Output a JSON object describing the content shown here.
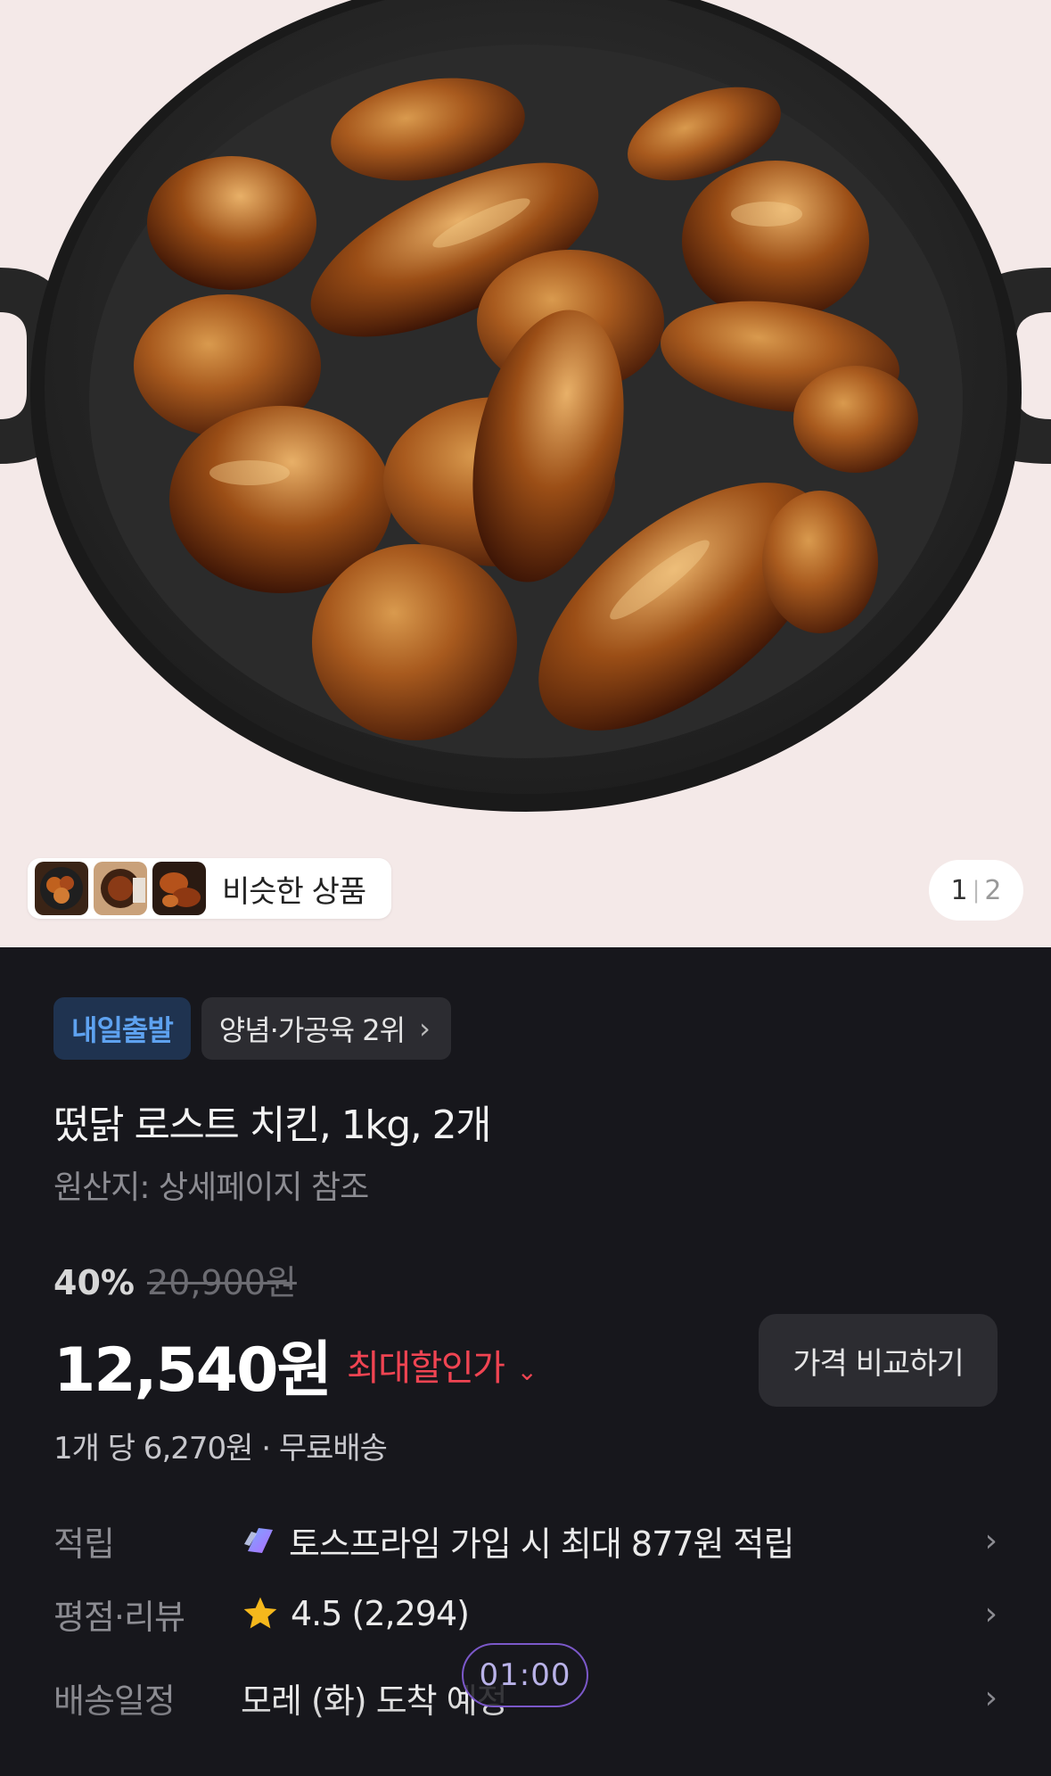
{
  "gallery": {
    "similar_label": "비슷한 상품",
    "page_current": "1",
    "page_separator": "|",
    "page_total": "2"
  },
  "badges": {
    "delivery": "내일출발",
    "rank": "양념·가공육 2위",
    "rank_chevron": "›"
  },
  "product": {
    "title": "떴닭 로스트 치킨, 1kg, 2개",
    "origin": "원산지: 상세페이지 참조"
  },
  "pricing": {
    "discount_percent": "40%",
    "original_price": "20,900원",
    "price": "12,540원",
    "max_discount_label": "최대할인가",
    "max_discount_chevron": "⌄",
    "compare_button": "가격 비교하기",
    "unit_price": "1개 당 6,270원 · 무료배송"
  },
  "details": [
    {
      "label": "적립",
      "value": "토스프라임 가입 시 최대 877원 적립",
      "icon": "toss-prime-icon"
    },
    {
      "label": "평점·리뷰",
      "value": "4.5 (2,294)",
      "icon": "star-icon"
    },
    {
      "label": "배송일정",
      "value": "모레 (화) 도착 예정",
      "icon": ""
    }
  ],
  "detail_chevron": "›",
  "timer": "01:00",
  "colors": {
    "background": "#17171c",
    "accent_red": "#f04452",
    "badge_blue": "#5ea2f0",
    "star": "#f5b81c"
  }
}
